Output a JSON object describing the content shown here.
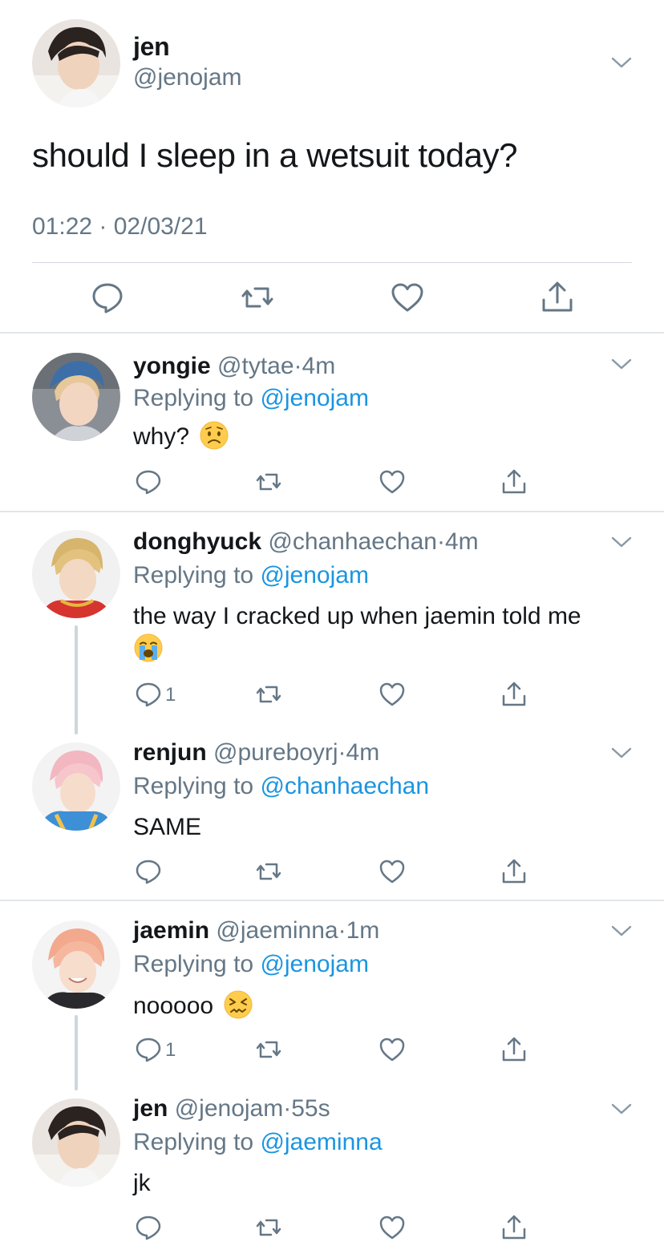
{
  "main_tweet": {
    "author_name": "jen",
    "author_handle": "@jenojam",
    "text": "should I sleep in a wetsuit today?",
    "timestamp": "01:22 · 02/03/21",
    "actions": [
      "reply-icon",
      "retweet-icon",
      "like-icon",
      "share-icon"
    ]
  },
  "replies": [
    {
      "name": "yongie",
      "handle": "@tytae",
      "dot": "·",
      "time": "4m",
      "replying_prefix": "Replying to ",
      "replying_to": "@jenojam",
      "text": "why?",
      "emoji": "worried-face-emoji",
      "reply_count": ""
    },
    {
      "name": "donghyuck",
      "handle": "@chanhaechan",
      "dot": "·",
      "time": "4m",
      "replying_prefix": "Replying to ",
      "replying_to": "@jenojam",
      "text": "the way I cracked up when jaemin told me",
      "emoji": "loudly-crying-face-emoji",
      "reply_count": "1"
    },
    {
      "name": "renjun",
      "handle": "@pureboyrj",
      "dot": "·",
      "time": "4m",
      "replying_prefix": "Replying to ",
      "replying_to": "@chanhaechan",
      "text": "SAME",
      "reply_count": ""
    },
    {
      "name": "jaemin",
      "handle": "@jaeminna",
      "dot": "·",
      "time": "1m",
      "replying_prefix": "Replying to ",
      "replying_to": "@jenojam",
      "text": "nooooo",
      "emoji": "confounded-face-emoji",
      "reply_count": "1"
    },
    {
      "name": "jen",
      "handle": "@jenojam",
      "dot": "·",
      "time": "55s",
      "replying_prefix": "Replying to ",
      "replying_to": "@jaeminna",
      "text": "jk",
      "reply_count": ""
    }
  ],
  "colors": {
    "link": "#1b95e0",
    "secondary_text": "#657786",
    "icon": "#657786",
    "divider": "#e1e6ea",
    "thread_line": "#ccd6dd"
  }
}
